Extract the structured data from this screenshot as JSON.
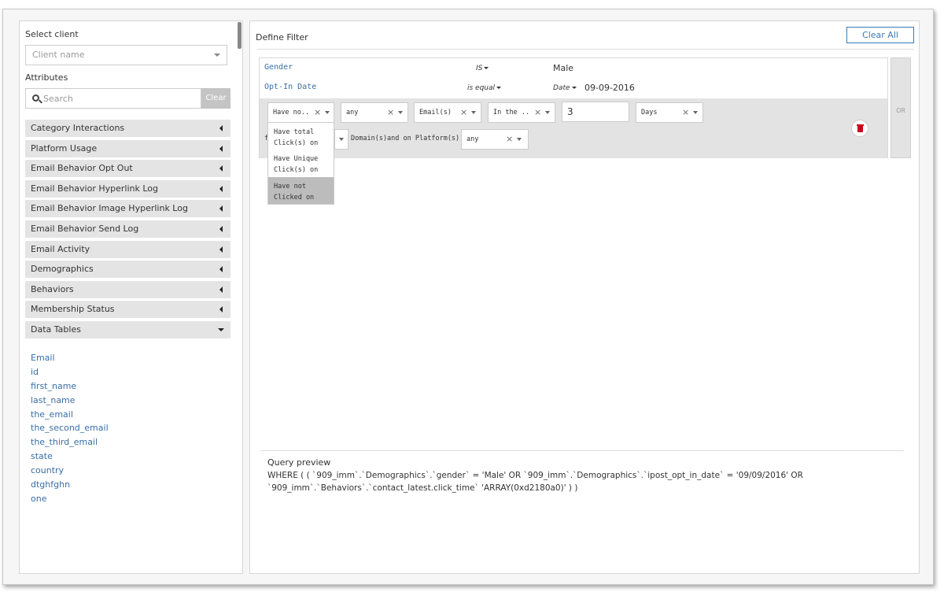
{
  "left": {
    "select_client_label": "Select client",
    "client_placeholder": "Client name",
    "attributes_label": "Attributes",
    "search_placeholder": "Search",
    "clear_label": "Clear",
    "categories": [
      "Category Interactions",
      "Platform Usage",
      "Email Behavior Opt Out",
      "Email Behavior Hyperlink Log",
      "Email Behavior Image Hyperlink Log",
      "Email Behavior Send Log",
      "Email Activity",
      "Demographics",
      "Behaviors",
      "Membership Status",
      "Data Tables"
    ],
    "data_table_fields": [
      "Email",
      "id",
      "first_name",
      "last_name",
      "the_email",
      "the_second_email",
      "the_third_email",
      "state",
      "country",
      "dtghfghn",
      "one"
    ]
  },
  "right": {
    "title": "Define Filter",
    "clear_all": "Clear All",
    "rules": [
      {
        "field": "Gender",
        "operator": "IS",
        "value": "Male"
      },
      {
        "field": "Opt-In Date",
        "operator": "is equal",
        "type": "Date",
        "value": "09-09-2016"
      }
    ],
    "condition": {
      "action": "Have no..",
      "qualifier": "any",
      "target": "Email(s)",
      "time_op": "In the ..",
      "amount": "3",
      "unit": "Days",
      "prefix": "f",
      "mid_text": "Domain(s)and on Platform(s) of",
      "platform": "any"
    },
    "or_label": "OR",
    "dropdown_options": [
      "Have total Click(s) on",
      "Have Unique Click(s) on",
      "Have not Clicked on"
    ],
    "query_label": "Query preview",
    "query_line1": "WHERE ( ( `909_imm`.`Demographics`.`gender` = 'Male' OR `909_imm`.`Demographics`.`ipost_opt_in_date` = '09/09/2016' OR",
    "query_line2": "`909_imm`.`Behaviors`.`contact_latest.click_time` 'ARRAY(0xd2180a0)' ) )"
  }
}
